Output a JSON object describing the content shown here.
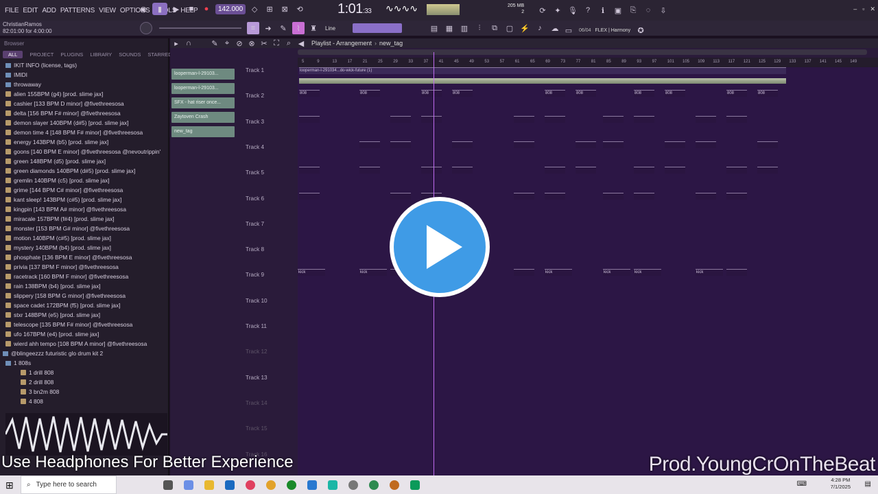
{
  "menu": [
    "FILE",
    "EDIT",
    "ADD",
    "PATTERNS",
    "VIEW",
    "OPTIONS",
    "TOOLS",
    "HELP"
  ],
  "transport": {
    "tempo": "142.000",
    "time": "1:01",
    "time_sub": ":33",
    "memory": "205 MB",
    "mem_num": "2"
  },
  "user": {
    "name": "ChristianRamos",
    "time": "82:01:00 for 4:00:00"
  },
  "snap": {
    "mode": "Line",
    "preset": "FLEX | Harmony",
    "counter": "06/04"
  },
  "browser": {
    "title": "Browser",
    "tabs": [
      "ALL",
      "PROJECT",
      "PLUGINS",
      "LIBRARY",
      "SOUNDS",
      "STARRED"
    ],
    "items": [
      {
        "t": "IKIT INFO (license, tags)",
        "k": "fold"
      },
      {
        "t": "IMIDI",
        "k": "fold"
      },
      {
        "t": "throwaway",
        "k": "fold"
      },
      {
        "t": "alien 155BPM (g4) [prod. slime jax]",
        "k": "file"
      },
      {
        "t": "cashier [133 BPM D minor] @fivethreesosa",
        "k": "file"
      },
      {
        "t": "delta [156 BPM F# minor] @fivethreesosa",
        "k": "file"
      },
      {
        "t": "demon slayer 140BPM (d#5) [prod. slime jax]",
        "k": "file"
      },
      {
        "t": "demon time 4 [148 BPM F# minor] @fivethreesosa",
        "k": "file"
      },
      {
        "t": "energy 143BPM (b5) [prod. slime jax]",
        "k": "file"
      },
      {
        "t": "goons [140 BPM E minor] @fivethreesosa @nevoutrippin'",
        "k": "file"
      },
      {
        "t": "green 148BPM (d5) [prod. slime jax]",
        "k": "file"
      },
      {
        "t": "green diamonds 140BPM (d#5) [prod. slime jax]",
        "k": "file"
      },
      {
        "t": "gremlin 140BPM (c5) [prod. slime jax]",
        "k": "file"
      },
      {
        "t": "grime [144 BPM C# minor] @fivethreesosa",
        "k": "file"
      },
      {
        "t": "kant sleep! 143BPM (c#5) [prod. slime jax]",
        "k": "file"
      },
      {
        "t": "kingpin [143 BPM A# minor] @fivethreesosa",
        "k": "file"
      },
      {
        "t": "miracale 157BPM (f#4) [prod. slime jax]",
        "k": "file"
      },
      {
        "t": "monster [153 BPM G# minor] @fivethreesosa",
        "k": "file"
      },
      {
        "t": "motion 140BPM (c#5) [prod. slime jax]",
        "k": "file"
      },
      {
        "t": "mystery 140BPM (b4) [prod. slime jax]",
        "k": "file"
      },
      {
        "t": "phosphate [136 BPM E minor] @fivethreesosa",
        "k": "file"
      },
      {
        "t": "privia [137 BPM F minor] @fivethreesosa",
        "k": "file"
      },
      {
        "t": "racetrack [160 BPM F minor] @fivethreesosa",
        "k": "file"
      },
      {
        "t": "rain 138BPM (b4) [prod. slime jax]",
        "k": "file"
      },
      {
        "t": "slippery [158 BPM G minor] @fivethreesosa",
        "k": "file"
      },
      {
        "t": "space cadet 172BPM (f5) [prod. slime jax]",
        "k": "file"
      },
      {
        "t": "stxr 148BPM (e5) [prod. slime jax]",
        "k": "file"
      },
      {
        "t": "telescope [135 BPM F# minor] @fivethreesosa",
        "k": "file"
      },
      {
        "t": "ufo 167BPM (e4) [prod. slime jax]",
        "k": "file"
      },
      {
        "t": "wierd ahh tempo [108 BPM A minor] @fivethreesosa",
        "k": "file"
      },
      {
        "t": "@blingeezzz futuristic glo drum kit 2",
        "k": "fold"
      },
      {
        "t": "1 808s",
        "k": "fold"
      },
      {
        "t": "1 drill 808",
        "k": "file"
      },
      {
        "t": "2 drill 808",
        "k": "file"
      },
      {
        "t": "3 bn2m 808",
        "k": "file"
      },
      {
        "t": "4 808",
        "k": "file"
      }
    ]
  },
  "playlist": {
    "title": "Playlist - Arrangement",
    "pattern": "new_tag",
    "ruler": [
      "5",
      "9",
      "13",
      "17",
      "21",
      "25",
      "29",
      "33",
      "37",
      "41",
      "45",
      "49",
      "53",
      "57",
      "61",
      "65",
      "69",
      "73",
      "77",
      "81",
      "85",
      "89",
      "93",
      "97",
      "101",
      "105",
      "109",
      "113",
      "117",
      "121",
      "125",
      "129",
      "133",
      "137",
      "141",
      "145",
      "149"
    ],
    "patterns": [
      "looperman-l-29103...",
      "looperman-l-29103...",
      "SFX - hat riser once...",
      "Zaytoven Crash",
      "new_tag"
    ],
    "tracks": [
      "Track 1",
      "Track 2",
      "Track 3",
      "Track 4",
      "Track 5",
      "Track 6",
      "Track 7",
      "Track 8",
      "Track 9",
      "Track 10",
      "Track 11",
      "Track 12",
      "Track 13",
      "Track 14",
      "Track 15",
      "Track 16"
    ],
    "clip_labels": {
      "t1": "looperman-l-291034...do-wick-future (1)",
      "t2": "808",
      "t9": "kick"
    }
  },
  "captions": {
    "left": "Use Headphones For Better Experience",
    "right": "Prod.YoungCrOnTheBeat"
  },
  "taskbar": {
    "search": "Type here to search",
    "time": "4:28 PM",
    "date": "7/1/2025"
  }
}
